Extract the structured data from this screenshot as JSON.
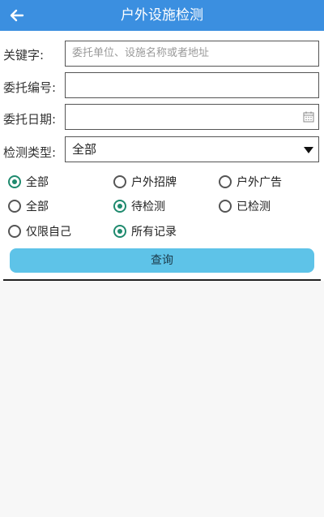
{
  "header": {
    "title": "户外设施检测"
  },
  "form": {
    "keyword_label": "关键字:",
    "keyword_placeholder": "委托单位、设施名称或者地址",
    "number_label": "委托编号:",
    "date_label": "委托日期:",
    "type_label": "检测类型:",
    "type_value": "全部"
  },
  "radios": {
    "row1": [
      "全部",
      "户外招牌",
      "户外广告"
    ],
    "row2": [
      "全部",
      "待检测",
      "已检测"
    ],
    "row3": [
      "仅限自己",
      "所有记录"
    ]
  },
  "query_label": "查询",
  "colors": {
    "header_bg": "#3b8fe0",
    "accent": "#1f8a6e",
    "button": "#5ec3e8"
  }
}
